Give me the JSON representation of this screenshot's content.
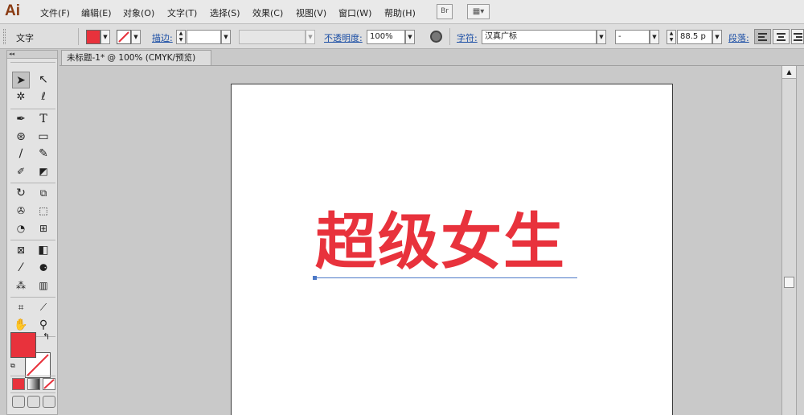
{
  "app": {
    "logo": "Ai",
    "menus": [
      "文件(F)",
      "编辑(E)",
      "对象(O)",
      "文字(T)",
      "选择(S)",
      "效果(C)",
      "视图(V)",
      "窗口(W)",
      "帮助(H)"
    ],
    "bridge_button": "Br",
    "workspace_icon": "grid-icon"
  },
  "control_bar": {
    "tool_name": "文字",
    "fill_color": "#e8323c",
    "stroke_label": "描边:",
    "opacity_label": "不透明度:",
    "opacity_value": "100%",
    "character_label": "字符:",
    "font_family": "汉真广标",
    "font_style": "-",
    "font_size": "88.5 p",
    "paragraph_label": "段落:"
  },
  "document": {
    "tab_title": "未标题-1* @ 100% (CMYK/预览)",
    "artboard_text": "超级女生",
    "text_color": "#e8323c",
    "selection_color": "#4d79c7"
  },
  "toolbox": {
    "fill_color": "#e8323c",
    "stroke_color": "#ffffff"
  }
}
